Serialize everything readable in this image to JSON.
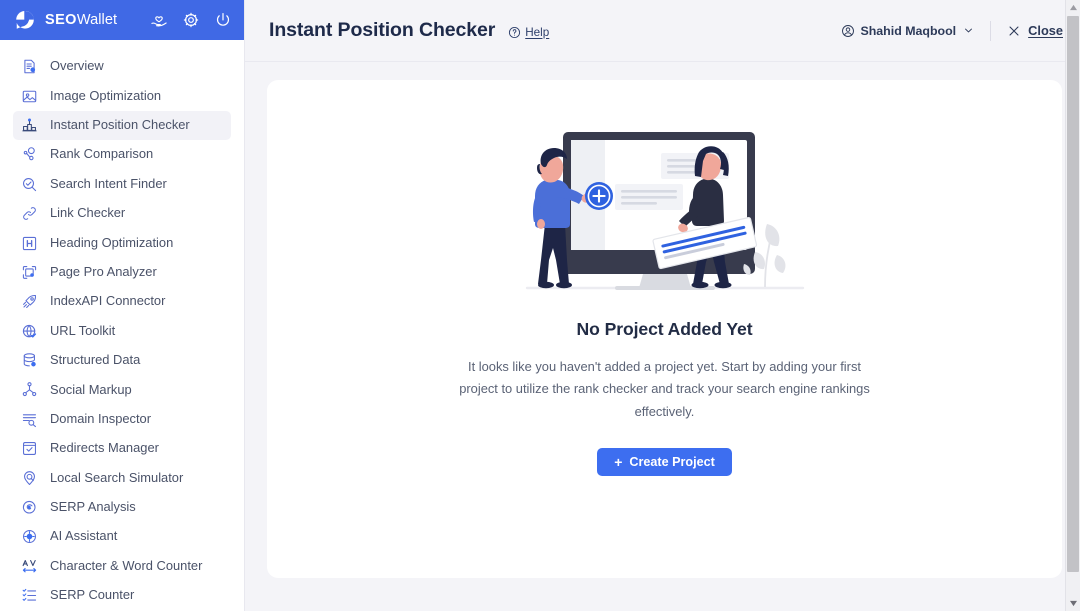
{
  "brand": {
    "logo_icon": "pie-chart-logo-icon",
    "name_bold": "SEO",
    "name_light": "Wallet",
    "icons": [
      {
        "name": "heart-hand-icon",
        "label": "Support"
      },
      {
        "name": "gear-icon",
        "label": "Settings"
      },
      {
        "name": "power-icon",
        "label": "Logout"
      }
    ]
  },
  "sidebar": {
    "items": [
      {
        "label": "Overview",
        "icon": "document-info-icon",
        "active": false
      },
      {
        "label": "Image Optimization",
        "icon": "image-icon",
        "active": false
      },
      {
        "label": "Instant Position Checker",
        "icon": "podium-chart-icon",
        "active": true
      },
      {
        "label": "Rank Comparison",
        "icon": "rank-nodes-icon",
        "active": false
      },
      {
        "label": "Search Intent Finder",
        "icon": "search-circle-icon",
        "active": false
      },
      {
        "label": "Link Checker",
        "icon": "link-chain-icon",
        "active": false
      },
      {
        "label": "Heading Optimization",
        "icon": "heading-h-icon",
        "active": false
      },
      {
        "label": "Page Pro Analyzer",
        "icon": "page-scan-icon",
        "active": false
      },
      {
        "label": "IndexAPI Connector",
        "icon": "rocket-icon",
        "active": false
      },
      {
        "label": "URL Toolkit",
        "icon": "globe-check-icon",
        "active": false
      },
      {
        "label": "Structured Data",
        "icon": "database-star-icon",
        "active": false
      },
      {
        "label": "Social Markup",
        "icon": "share-nodes-icon",
        "active": false
      },
      {
        "label": "Domain Inspector",
        "icon": "list-search-icon",
        "active": false
      },
      {
        "label": "Redirects Manager",
        "icon": "checkbox-square-icon",
        "active": false
      },
      {
        "label": "Local Search Simulator",
        "icon": "location-search-icon",
        "active": false
      },
      {
        "label": "SERP Analysis",
        "icon": "serp-eye-icon",
        "active": false
      },
      {
        "label": "AI Assistant",
        "icon": "ai-circle-icon",
        "active": false
      },
      {
        "label": "Character & Word Counter",
        "icon": "av-arrows-icon",
        "active": false
      },
      {
        "label": "SERP Counter",
        "icon": "checklist-icon",
        "active": false
      }
    ]
  },
  "topbar": {
    "title": "Instant Position Checker",
    "help_label": "Help",
    "help_icon": "question-circle-icon",
    "user_name": "Shahid Maqbool",
    "user_icon": "user-circle-icon",
    "chevron_icon": "chevron-down-icon",
    "close_label": "Close",
    "close_icon": "x-close-icon"
  },
  "empty_state": {
    "illustration": "people-adding-project-illustration",
    "title": "No Project Added Yet",
    "description": "It looks like you haven't added a project yet. Start by adding your first project to utilize the rank checker and track your search engine rankings effectively.",
    "button_label": "Create Project",
    "button_icon": "plus-icon"
  },
  "scrollbar": {
    "up_icon": "scroll-up-arrow-icon",
    "down_icon": "scroll-down-arrow-icon",
    "thumb": "scrollbar-thumb"
  },
  "colors": {
    "brand_blue": "#4069e5",
    "button_blue": "#3d6ef0",
    "page_bg": "#f4f4f8",
    "card_bg": "#ffffff",
    "title_ink": "#1e2a4a",
    "nav_ink": "#4a5268"
  }
}
